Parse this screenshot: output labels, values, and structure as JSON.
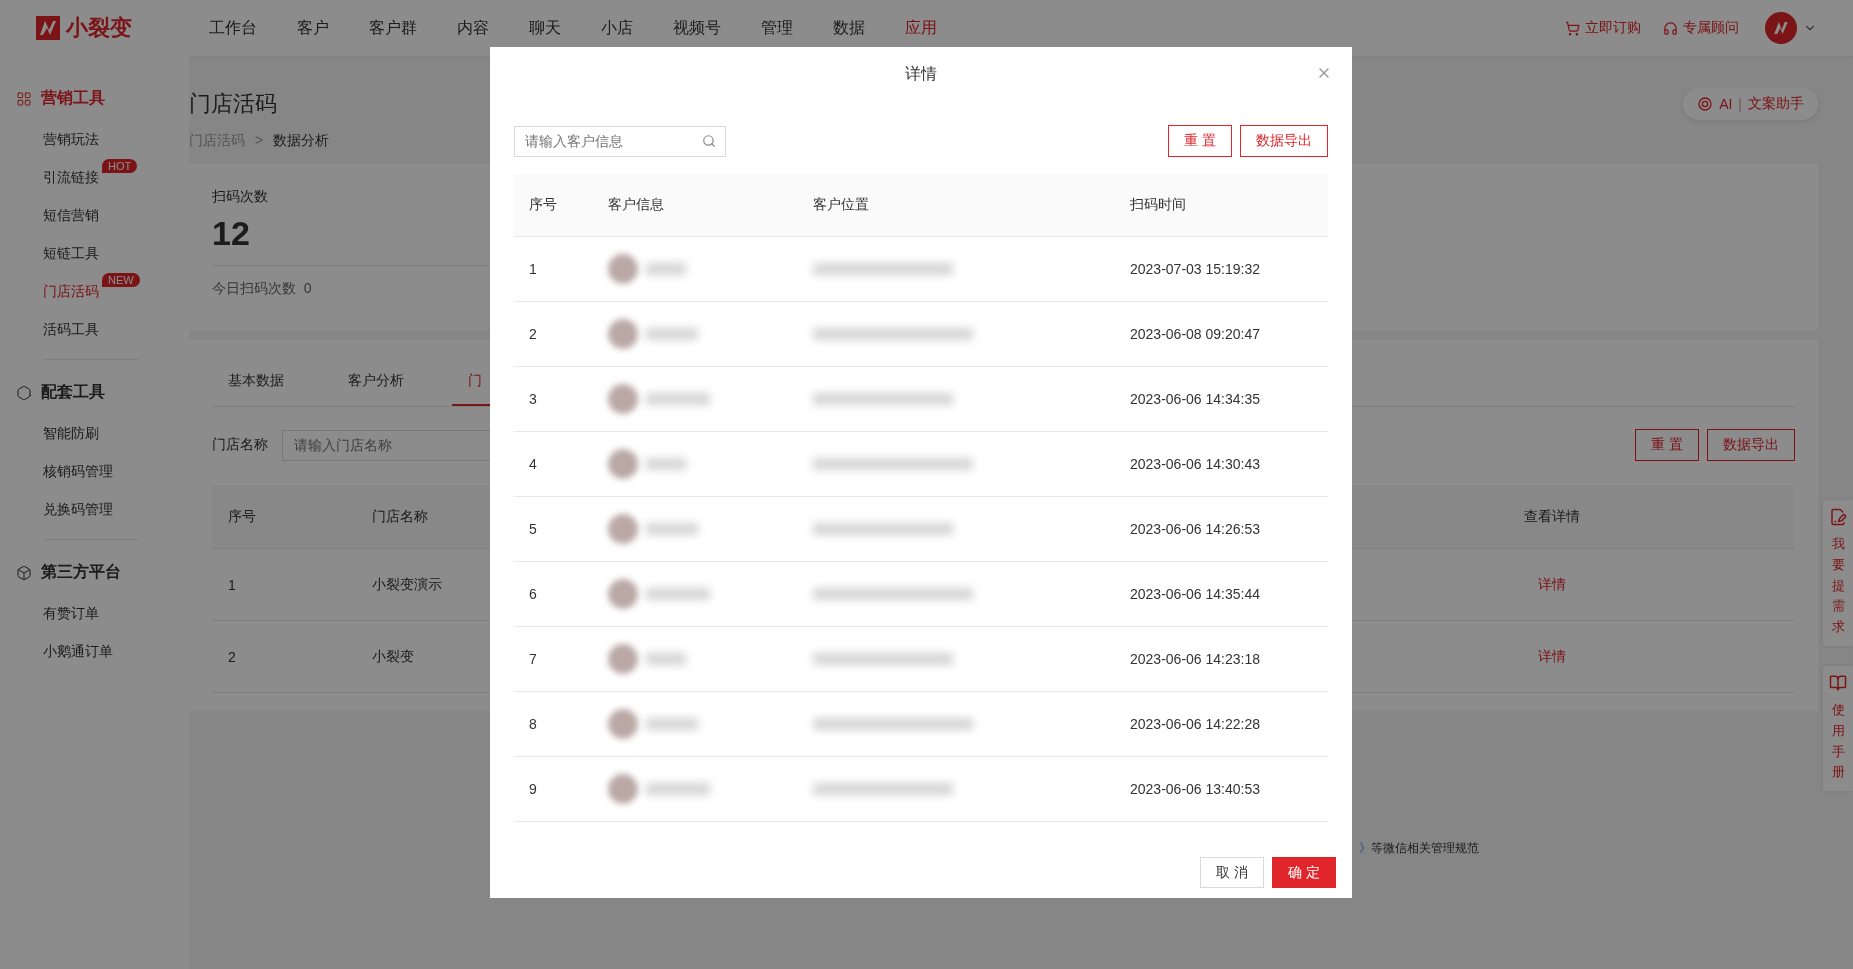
{
  "top_nav": {
    "brand": "小裂变",
    "items": [
      {
        "label": "工作台",
        "selected": false
      },
      {
        "label": "客户",
        "selected": false
      },
      {
        "label": "客户群",
        "selected": false
      },
      {
        "label": "内容",
        "selected": false
      },
      {
        "label": "聊天",
        "selected": false
      },
      {
        "label": "小店",
        "selected": false
      },
      {
        "label": "视频号",
        "selected": false
      },
      {
        "label": "管理",
        "selected": false
      },
      {
        "label": "数据",
        "selected": false
      },
      {
        "label": "应用",
        "selected": true
      }
    ],
    "actions": [
      {
        "kind": "cart",
        "label": "立即订购"
      },
      {
        "kind": "headset",
        "label": "专属顾问"
      }
    ]
  },
  "sidebar": {
    "sections": [
      {
        "kind": "grid",
        "title": "营销工具",
        "selected": true,
        "items": [
          {
            "label": "营销玩法",
            "selected": false
          },
          {
            "label": "引流链接",
            "selected": false,
            "badge": "HOT"
          },
          {
            "label": "短信营销",
            "selected": false
          },
          {
            "label": "短链工具",
            "selected": false
          },
          {
            "label": "门店活码",
            "selected": true,
            "badge": "NEW"
          },
          {
            "label": "活码工具",
            "selected": false
          }
        ]
      },
      {
        "kind": "hexagon",
        "title": "配套工具",
        "selected": false,
        "items": [
          {
            "label": "智能防刷",
            "selected": false
          },
          {
            "label": "核销码管理",
            "selected": false
          },
          {
            "label": "兑换码管理",
            "selected": false
          }
        ]
      },
      {
        "kind": "cube",
        "title": "第三方平台",
        "selected": false,
        "items": [
          {
            "label": "有赞订单",
            "selected": false
          },
          {
            "label": "小鹅通订单",
            "selected": false
          }
        ]
      }
    ]
  },
  "page": {
    "title": "门店活码",
    "ai_button": {
      "prefix": "AI",
      "separator": "|",
      "label": "文案助手"
    },
    "breadcrumb_separator": ">",
    "breadcrumb": [
      {
        "label": "门店活码",
        "current": false
      },
      {
        "label": "数据分析",
        "current": true
      }
    ],
    "stats": {
      "label": "扫码次数",
      "value": "12",
      "today_label": "今日扫码次数",
      "today_value": "0"
    },
    "tabs": [
      {
        "label": "基本数据",
        "selected": false
      },
      {
        "label": "客户分析",
        "selected": false
      },
      {
        "label": "门",
        "selected": true
      }
    ],
    "filter": {
      "label": "门店名称",
      "placeholder": "请输入门店名称",
      "buttons": [
        "重 置",
        "数据导出"
      ]
    },
    "table": {
      "columns": [
        "序号",
        "门店名称",
        "查看详情"
      ],
      "rows": [
        {
          "index": "1",
          "name": "小裂变演示",
          "link": "详情"
        },
        {
          "index": "2",
          "name": "小裂变",
          "link": "详情"
        }
      ]
    },
    "notice": {
      "link": "》",
      "text": "等微信相关管理规范"
    }
  },
  "side_tabs": [
    {
      "kind": "edit",
      "label": "我要提需求"
    },
    {
      "kind": "book",
      "label": "使用手册"
    }
  ],
  "modal": {
    "title": "详情",
    "search": {
      "placeholder": "请输入客户信息"
    },
    "buttons": [
      "重 置",
      "数据导出"
    ],
    "table": {
      "columns": [
        "序号",
        "客户信息",
        "客户位置",
        "扫码时间"
      ],
      "rows": [
        {
          "index": "1",
          "time": "2023-07-03 15:19:32"
        },
        {
          "index": "2",
          "time": "2023-06-08 09:20:47"
        },
        {
          "index": "3",
          "time": "2023-06-06 14:34:35"
        },
        {
          "index": "4",
          "time": "2023-06-06 14:30:43"
        },
        {
          "index": "5",
          "time": "2023-06-06 14:26:53"
        },
        {
          "index": "6",
          "time": "2023-06-06 14:35:44"
        },
        {
          "index": "7",
          "time": "2023-06-06 14:23:18"
        },
        {
          "index": "8",
          "time": "2023-06-06 14:22:28"
        },
        {
          "index": "9",
          "time": "2023-06-06 13:40:53"
        }
      ]
    },
    "footer": [
      {
        "kind": "cancel",
        "label": "取 消"
      },
      {
        "kind": "confirm",
        "label": "确 定"
      }
    ]
  }
}
